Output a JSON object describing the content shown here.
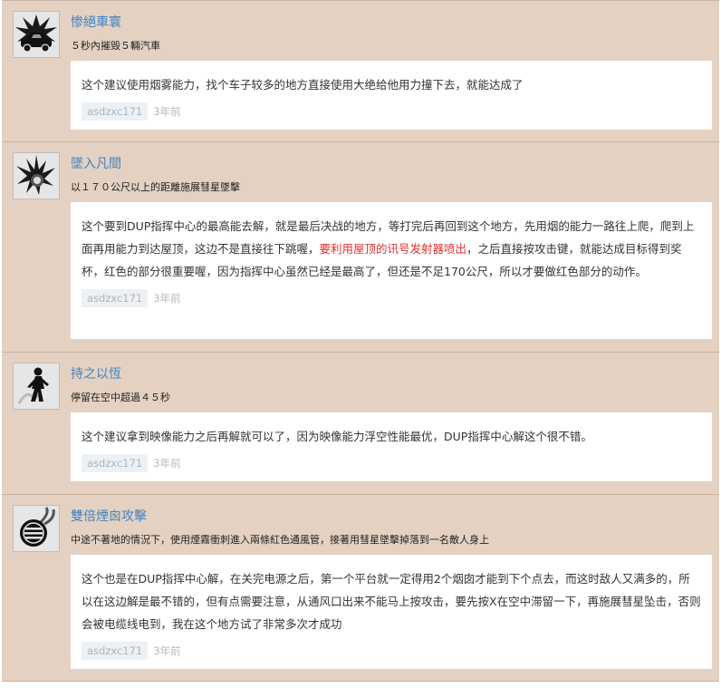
{
  "achievements": [
    {
      "title": "惨絕車寰",
      "desc": "５秒內摧毀５輛汽車",
      "icon": "car-explosion-icon",
      "comment": {
        "parts": [
          "这个建议使用烟雾能力，找个车子较多的地方直接使用大绝给他用力撞下去，就能达成了"
        ],
        "user": "asdzxc171",
        "time": "3年前"
      }
    },
    {
      "title": "墜入凡間",
      "desc": "以１７０公尺以上的距離施展彗星墜擊",
      "icon": "meteor-icon",
      "comment": {
        "parts": [
          "这个要到DUP指挥中心的最高能去解，就是最后决战的地方，等打完后再回到这个地方，先用烟的能力一路往上爬，爬到上面再用能力到达屋顶，这边不是直接往下跳喔，",
          "要利用屋顶的讯号发射器喷出",
          "，之后直接按攻击键，就能达成目标得到奖杯，红色的部分很重要喔，因为指挥中心虽然已经是最高了，但还是不足170公尺，所以才要做红色部分的动作。"
        ],
        "user": "asdzxc171",
        "time": "3年前"
      }
    },
    {
      "title": "持之以恆",
      "desc": "停留在空中超過４５秒",
      "icon": "floating-figure-icon",
      "comment": {
        "parts": [
          "这个建议拿到映像能力之后再解就可以了，因为映像能力浮空性能最优，DUP指挥中心解这个很不错。"
        ],
        "user": "asdzxc171",
        "time": "3年前"
      }
    },
    {
      "title": "雙倍煙囪攻擊",
      "desc": "中途不著地的情況下，使用煙霧衝刺進入兩條紅色通風管，接著用彗星墜擊掉落到一名敵人身上",
      "icon": "smoke-vent-icon",
      "comment": {
        "parts": [
          "这个也是在DUP指挥中心解，在关完电源之后，第一个平台就一定得用2个烟囱才能到下个点去，而这时敌人又满多的，所以在这边解是最不错的，但有点需要注意，从通风口出来不能马上按攻击，要先按X在空中滞留一下，再施展彗星坠击，否则会被电缆线电到，我在这个地方试了非常多次才成功"
        ],
        "user": "asdzxc171",
        "time": "3年前"
      }
    }
  ],
  "colors": {
    "card_bg": "#e4d1c1",
    "title": "#3f82c6",
    "highlight": "#e03030"
  }
}
